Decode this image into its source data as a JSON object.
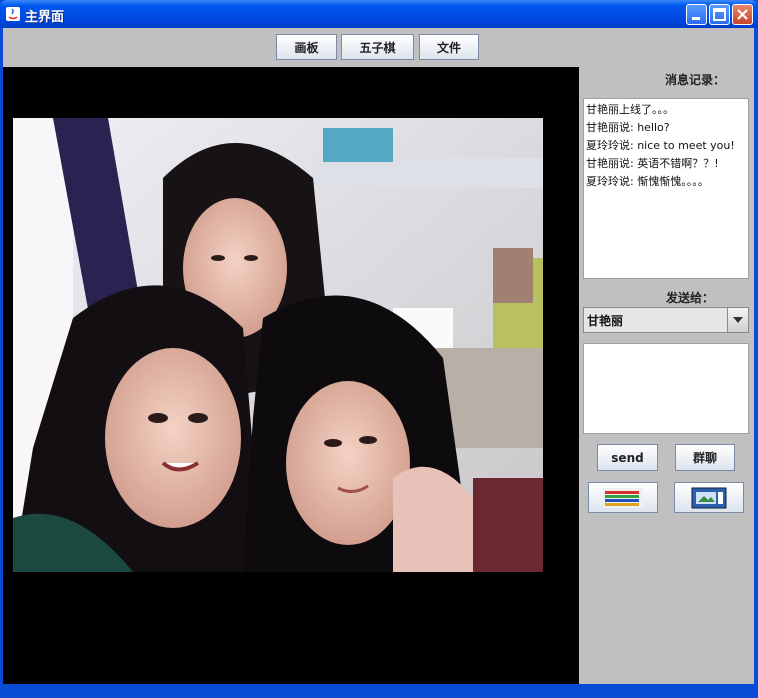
{
  "window": {
    "title": "主界面"
  },
  "toolbar": {
    "drawing_board": "画板",
    "gomoku": "五子棋",
    "file": "文件"
  },
  "side": {
    "history_label": "消息记录：",
    "messages": [
      "甘艳丽上线了。。。",
      "甘艳丽说: hello?",
      "夏玲玲说: nice to meet you!",
      "甘艳丽说: 英语不错啊？？!",
      "夏玲玲说: 惭愧惭愧。。。。"
    ],
    "send_to_label": "发送给：",
    "recipient": "甘艳丽",
    "send_label": "send",
    "group_chat_label": "群聊"
  },
  "colors": {
    "titlebar": "#0058ee",
    "client": "#c0c0c0",
    "video_bg": "#000000"
  }
}
